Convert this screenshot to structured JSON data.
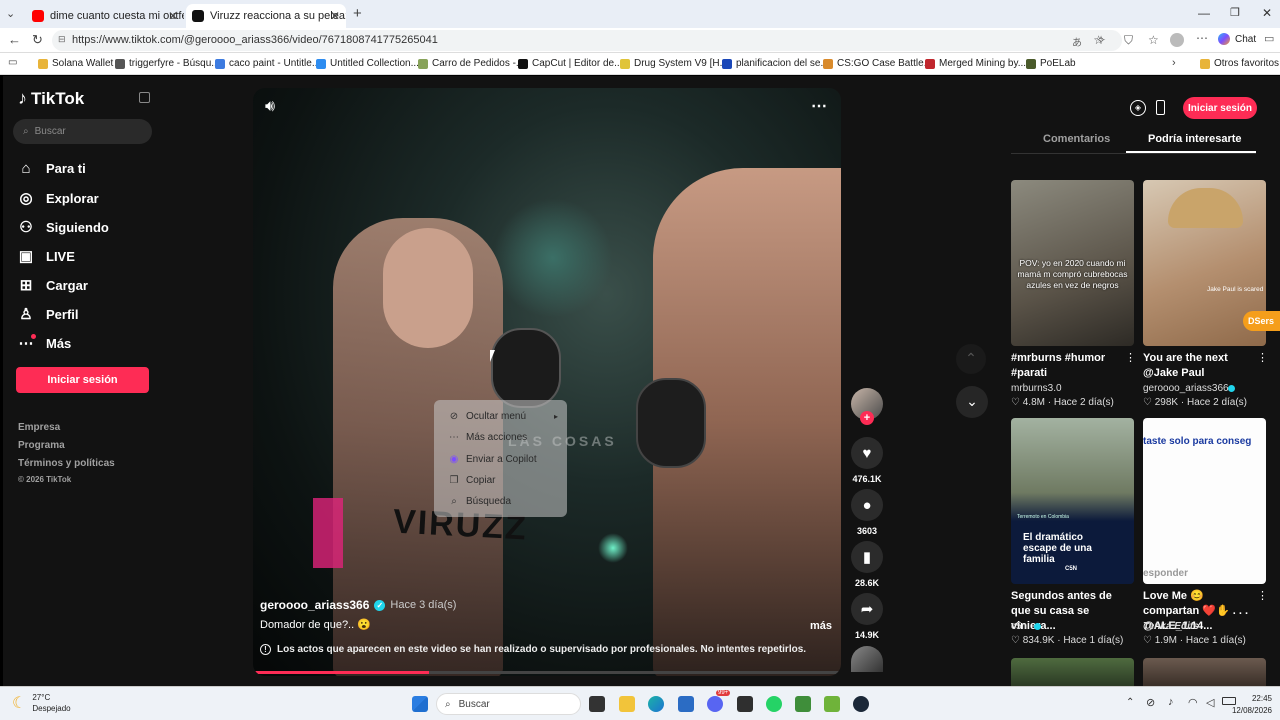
{
  "browser": {
    "tabs": [
      {
        "title": "dime cuanto cuesta mi outfeet cal",
        "favicon": "youtube-icon"
      },
      {
        "title": "Viruzz reacciona a su pelea: ¡Soy c",
        "favicon": "tiktok-icon"
      }
    ],
    "url": "https://www.tiktok.com/@geroooo_ariass366/video/7671808741775265041",
    "chat_label": "Chat",
    "bookmarks": [
      "Solana Wallet",
      "triggerfyre - Búsqu...",
      "caco paint - Untitle...",
      "Untitled Collection...",
      "Carro de Pedidos -...",
      "CapCut | Editor de...",
      "Drug System V9 [H...",
      "planificacion del se...",
      "CS:GO Case Battle...",
      "Merged Mining by...",
      "PoELab"
    ],
    "other_favorites": "Otros favoritos"
  },
  "sidebar": {
    "logo": "TikTok",
    "search_placeholder": "Buscar",
    "nav": [
      {
        "label": "Para ti",
        "icon": "home-icon"
      },
      {
        "label": "Explorar",
        "icon": "compass-icon"
      },
      {
        "label": "Siguiendo",
        "icon": "following-icon"
      },
      {
        "label": "LIVE",
        "icon": "live-icon"
      },
      {
        "label": "Cargar",
        "icon": "upload-icon"
      },
      {
        "label": "Perfil",
        "icon": "profile-icon"
      },
      {
        "label": "Más",
        "icon": "more-icon"
      }
    ],
    "login_button": "Iniciar sesión",
    "links": [
      "Empresa",
      "Programa",
      "Términos y políticas"
    ],
    "copyright": "© 2026 TikTok"
  },
  "video": {
    "author": "geroooo_ariass366",
    "time": "Hace 3 día(s)",
    "caption": "Domador de que?.. 😮",
    "more": "más",
    "overlay_text": "LAS COSAS",
    "shorts_text": "VIRUZZ",
    "disclaimer": "Los actos que aparecen en este video se han realizado o supervisado por profesionales. No intentes repetirlos.",
    "progress": 0.3
  },
  "actions": {
    "likes": "476.1K",
    "comments": "3603",
    "saves": "28.6K",
    "shares": "14.9K"
  },
  "context_menu": {
    "items": [
      {
        "label": "Ocultar menú",
        "icon": "hide-icon"
      },
      {
        "label": "Más acciones",
        "icon": "dots-icon"
      },
      {
        "label": "Enviar a Copilot",
        "icon": "copilot-icon"
      },
      {
        "label": "Copiar",
        "icon": "copy-icon"
      },
      {
        "label": "Búsqueda",
        "icon": "search-icon"
      }
    ]
  },
  "right_panel": {
    "login_button": "Iniciar sesión",
    "tabs": [
      "Comentarios",
      "Podría interesarte"
    ],
    "dsers_badge": "DSers",
    "cards": [
      {
        "title": "#mrburns #humor #parati",
        "author": "mrburns3.0",
        "meta": "♡ 4.8M  ·  Hace 2 día(s)",
        "overlay": "POV: yo en 2020 cuando mi mamá m compró cubrebocas azules en vez de negros"
      },
      {
        "title": "You are the next @Jake Paul",
        "author": "geroooo_ariass366",
        "meta": "♡ 298K  ·  Hace 2 día(s)",
        "overlay": "Jake Paul is scared"
      },
      {
        "title": "Segundos antes de que su casa se viniera...",
        "author": "c5n",
        "meta": "♡ 834.9K  ·  Hace 1 día(s)",
        "overlay": "El dramático escape de una familia",
        "badge": "C5N",
        "kicker": "Terremoto en Colombia"
      },
      {
        "title": "Love Me 😊 compartan ❤️✋ . . . @ALE_1.14...",
        "author": "Tenka Edits",
        "meta": "♡ 1.9M  ·  Hace 1 día(s)",
        "overlay": "taste solo para conseg",
        "overlay2": "esponder"
      }
    ]
  },
  "taskbar": {
    "weather_temp": "27°C",
    "weather_desc": "Despejado",
    "search_placeholder": "Buscar",
    "time": "22:45",
    "date": "12/08/2026",
    "badge": "99+"
  },
  "colors": {
    "accent": "#fe2c55",
    "bg": "#121212"
  }
}
